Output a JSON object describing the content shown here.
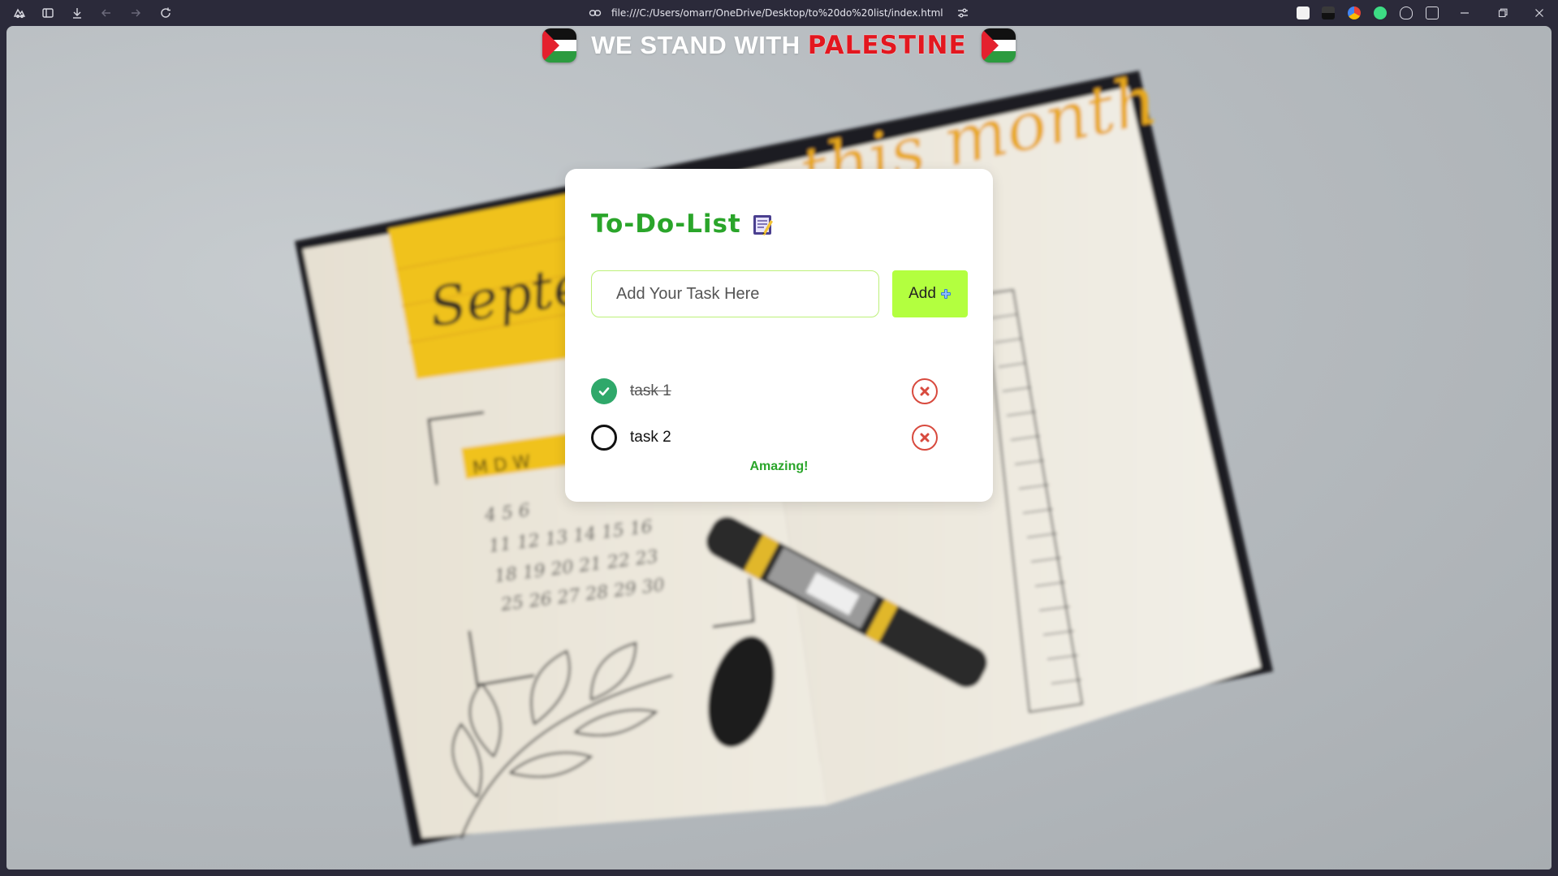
{
  "browser": {
    "url": "file:///C:/Users/omarr/OneDrive/Desktop/to%20do%20list/index.html",
    "icons": [
      "workspaces-icon",
      "sidebar-icon",
      "download-icon",
      "back-icon",
      "forward-icon",
      "reload-icon",
      "link-icon",
      "tune-icon"
    ]
  },
  "banner": {
    "text": "WE STAND WITH ",
    "accent": "PALESTINE",
    "flag_icon": "palestine-flag-icon"
  },
  "app": {
    "title": "To-Do-List",
    "title_icon": "notepad-icon",
    "input": {
      "placeholder": "Add Your Task Here",
      "value": ""
    },
    "add_button": {
      "label": "Add",
      "icon": "plus-icon"
    },
    "tasks": [
      {
        "text": "task 1",
        "completed": true
      },
      {
        "text": "task 2",
        "completed": false
      }
    ],
    "status_message": "Amazing!"
  },
  "colors": {
    "title_green": "#2aa52a",
    "add_button": "#b3ff3f",
    "input_border": "#bdf07a",
    "check_done": "#2fa86a",
    "remove_red": "#d84a3e",
    "banner_red": "#e3171f"
  }
}
